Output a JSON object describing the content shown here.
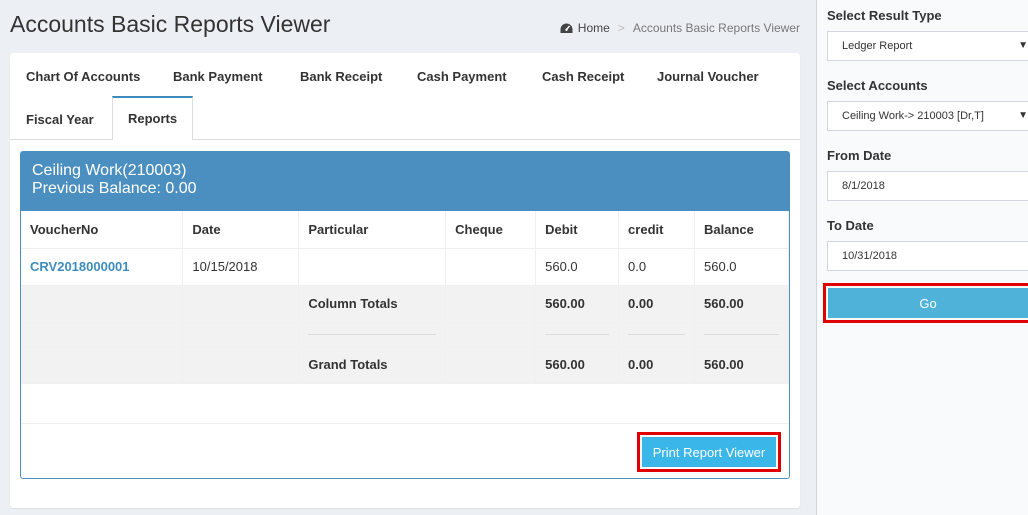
{
  "header": {
    "title": "Accounts Basic Reports Viewer",
    "breadcrumb": {
      "home": "Home",
      "separator": ">",
      "current": "Accounts Basic Reports Viewer"
    }
  },
  "tabs": [
    {
      "label": "Chart Of Accounts"
    },
    {
      "label": "Bank Payment"
    },
    {
      "label": "Bank Receipt"
    },
    {
      "label": "Cash Payment"
    },
    {
      "label": "Cash Receipt"
    },
    {
      "label": "Journal Voucher"
    },
    {
      "label": "Fiscal Year"
    },
    {
      "label": "Reports"
    }
  ],
  "report": {
    "account_title": "Ceiling Work(210003)",
    "previous_balance": "Previous Balance: 0.00",
    "columns": [
      "VoucherNo",
      "Date",
      "Particular",
      "Cheque",
      "Debit",
      "credit",
      "Balance"
    ],
    "rows": [
      {
        "voucher": "CRV2018000001",
        "date": "10/15/2018",
        "particular": "",
        "cheque": "",
        "debit": "560.0",
        "credit": "0.0",
        "balance": "560.0"
      }
    ],
    "column_totals": {
      "label": "Column Totals",
      "debit": "560.00",
      "credit": "0.00",
      "balance": "560.00"
    },
    "grand_totals": {
      "label": "Grand Totals",
      "debit": "560.00",
      "credit": "0.00",
      "balance": "560.00"
    },
    "print_button": "Print Report Viewer"
  },
  "sidebar": {
    "result_type_label": "Select Result Type",
    "result_type_value": "Ledger Report",
    "accounts_label": "Select Accounts",
    "accounts_value": "Ceiling Work-> 210003 [Dr,T]",
    "from_date_label": "From Date",
    "from_date_value": "8/1/2018",
    "to_date_label": "To Date",
    "to_date_value": "10/31/2018",
    "go_button": "Go"
  },
  "colors": {
    "accent": "#3c8dbc",
    "report_header": "#4b8fc0",
    "button": "#3ab7e8",
    "highlight": "#e00000"
  }
}
